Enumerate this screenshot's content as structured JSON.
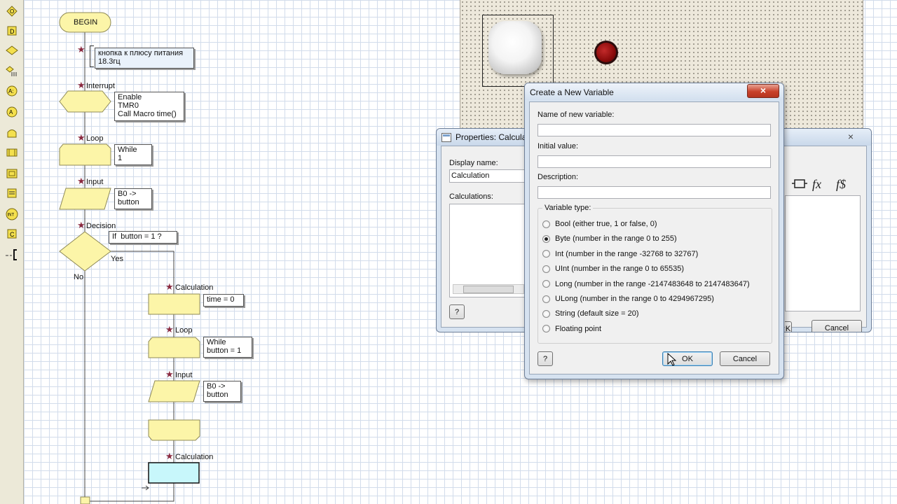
{
  "toolbar": {
    "tools": [
      "output-icon",
      "delay-icon",
      "decision-icon",
      "switch-icon",
      "calculation-icon",
      "input-icon",
      "loop-icon",
      "macro-icon",
      "component-macro-icon",
      "string-icon",
      "interrupt-icon",
      "c-code-icon",
      "comment-icon"
    ]
  },
  "flowchart": {
    "begin": "BEGIN",
    "comment_note": "кнопка к плюсу питания\n18.3гц",
    "interrupt_label": "Interrupt",
    "interrupt_note": "Enable\nTMR0\nCall Macro time()",
    "loop1_label": "Loop",
    "loop1_note": "While\n1",
    "input1_label": "Input",
    "input1_note": "B0 ->\nbutton",
    "decision_label": "Decision",
    "decision_note": "If  button = 1 ?",
    "yes": "Yes",
    "no": "No",
    "calc1_label": "Calculation",
    "calc1_note": "time = 0",
    "loop2_label": "Loop",
    "loop2_note": "While\nbutton = 1",
    "input2_label": "Input",
    "input2_note": "B0 ->\nbutton",
    "calc2_label": "Calculation"
  },
  "properties": {
    "title": "Properties: Calculat",
    "display_name_label": "Display name:",
    "display_name_value": "Calculation",
    "calculations_label": "Calculations:",
    "help": "?",
    "ok_partial": "K",
    "cancel": "Cancel",
    "close": "×"
  },
  "dialog": {
    "title": "Create a New Variable",
    "close": "×",
    "name_label": "Name of new variable:",
    "name_value": "",
    "initial_label": "Initial value:",
    "initial_value": "",
    "description_label": "Description:",
    "description_value": "",
    "type_group": "Variable type:",
    "types": [
      "Bool (either true, 1 or false, 0)",
      "Byte (number in the range 0 to 255)",
      "Int (number in the range -32768 to 32767)",
      "UInt (number in the range 0 to 65535)",
      "Long (number in the range -2147483648 to 2147483647)",
      "ULong (number in the range 0 to 4294967295)",
      "String (default size = 20)",
      "Floating point"
    ],
    "selected_type": "Byte (number in the range 0 to 255)",
    "help": "?",
    "ok": "OK",
    "cancel": "Cancel"
  },
  "colors": {
    "shape_fill": "#fcf5a8",
    "selected_shape": "#c8f7fb",
    "led": "#8a0b0b"
  }
}
